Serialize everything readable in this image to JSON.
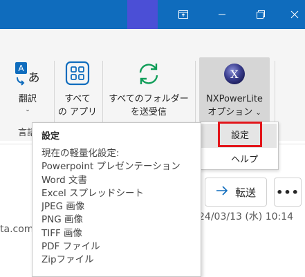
{
  "ribbon": {
    "translate": {
      "label": "翻訳",
      "chevron": "⌄",
      "icon": "translate-icon"
    },
    "all_apps": {
      "line1": "すべて",
      "line2": "の アプリ",
      "icon": "apps-grid-icon"
    },
    "send_receive": {
      "line1": "すべてのフォルダー",
      "line2": "を送受信",
      "icon": "sync-icon"
    },
    "nxpowerlite": {
      "line1": "NXPowerLite",
      "line2": "オプション",
      "chevron": "⌄",
      "icon": "nxpowerlite-logo-icon"
    },
    "group_label": "言語"
  },
  "menu": {
    "settings": "設定",
    "help": "ヘルプ"
  },
  "tooltip": {
    "title": "設定",
    "lines": [
      "現在の軽量化設定:",
      "Powerpoint プレゼンテーション",
      "Word 文書",
      "Excel スプレッドシート",
      "JPEG 画像",
      "PNG 画像",
      "TIFF 画像",
      "PDF ファイル",
      "Zipファイル"
    ]
  },
  "message": {
    "forward_label": "転送",
    "more_label": "•••",
    "datetime": "24/03/13 (水) 10:14",
    "email_fragment": "ta.com"
  },
  "colors": {
    "titlebar": "#0f6cbd",
    "accent_block": "#4b4fd6",
    "highlight_red": "#e3151a"
  }
}
